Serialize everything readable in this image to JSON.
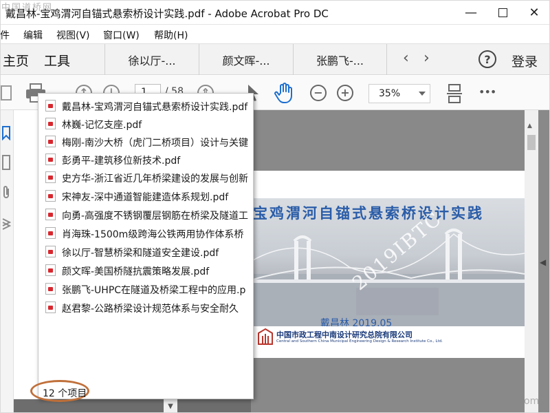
{
  "window": {
    "title": "戴昌林-宝鸡渭河自锚式悬索桥设计实践.pdf - Adobe Acrobat Pro DC",
    "minimize_label": "—",
    "close_label": "✕"
  },
  "menu": {
    "items": [
      {
        "label": "件"
      },
      {
        "label": "编辑"
      },
      {
        "label": "视图(V)"
      },
      {
        "label": "窗口(W)"
      },
      {
        "label": "帮助(H)"
      }
    ]
  },
  "nav": {
    "home_label": "主页",
    "tools_label": "工具",
    "tabs": [
      {
        "label": "徐以厅-..."
      },
      {
        "label": "颜文晖-..."
      },
      {
        "label": "张鹏飞-..."
      }
    ],
    "prev_arrow": "‹",
    "next_arrow": "›",
    "help_glyph": "?",
    "login_label": "登录"
  },
  "toolbar": {
    "current_page": "1",
    "total_pages": "/ 58",
    "zoom": "35%",
    "more_glyph": "•••"
  },
  "dropdown": {
    "items": [
      {
        "label": "戴昌林-宝鸡渭河自锚式悬索桥设计实践.pdf"
      },
      {
        "label": "林巍-记忆支座.pdf"
      },
      {
        "label": "梅刚-南沙大桥（虎门二桥项目）设计与关键"
      },
      {
        "label": "彭勇平-建筑移位新技术.pdf"
      },
      {
        "label": "史方华-浙江省近几年桥梁建设的发展与创新"
      },
      {
        "label": "宋神友-深中通道智能建造体系规划.pdf"
      },
      {
        "label": "向勇-高强度不锈钢覆层钢筋在桥梁及隧道工"
      },
      {
        "label": "肖海珠-1500m级跨海公铁两用协作体系桥"
      },
      {
        "label": "徐以厅-智慧桥梁和隧道安全建设.pdf"
      },
      {
        "label": "颜文晖-美国桥隧抗震策略发展.pdf"
      },
      {
        "label": "张鹏飞-UHPC在隧道及桥梁工程中的应用.p"
      },
      {
        "label": "赵君黎-公路桥梁设计规范体系与安全耐久"
      }
    ],
    "count_label": "12 个项目"
  },
  "document": {
    "cover_title": "宝鸡渭河自锚式悬索桥设计实践",
    "author_date": "戴昌林    2019.05",
    "watermark": "2019IBTC",
    "company_cn": "中国市政工程中南设计研究总院有限公司",
    "company_en": "Central and Southern China Municipal Engineering Design & Research Institute Co., Ltd."
  },
  "overlay": {
    "site_watermark": "中国道桥网",
    "corner_watermark": "om"
  },
  "colors": {
    "accent_blue": "#2a5ca8",
    "pdf_red": "#d7282f",
    "oval_orange": "#c0703a"
  }
}
